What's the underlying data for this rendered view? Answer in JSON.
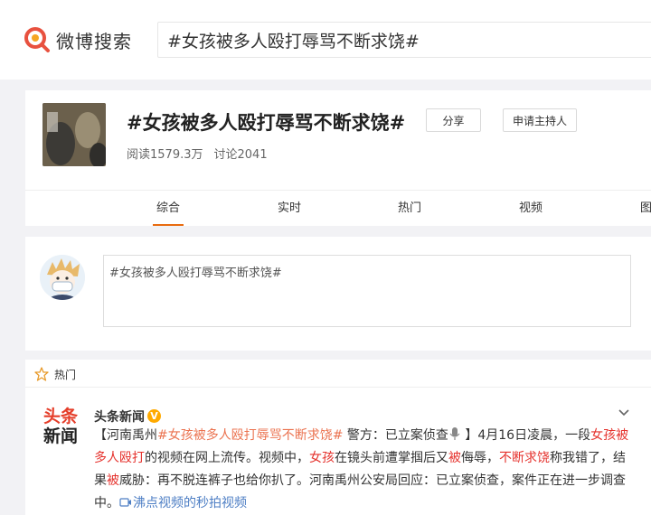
{
  "header": {
    "logo_text": "微博搜索",
    "search_value": "#女孩被多人殴打辱骂不断求饶#"
  },
  "topic": {
    "title": "#女孩被多人殴打辱骂不断求饶#",
    "share_label": "分享",
    "host_label": "申请主持人",
    "reads": "阅读1579.3万",
    "discussions": "讨论2041"
  },
  "tabs": [
    {
      "label": "综合",
      "active": true
    },
    {
      "label": "实时"
    },
    {
      "label": "热门"
    },
    {
      "label": "视频"
    },
    {
      "label": "图"
    }
  ],
  "composer": {
    "value": "#女孩被多人殴打辱骂不断求饶#"
  },
  "feed": {
    "section_label": "热门",
    "source_logo_line1": "头条",
    "source_logo_line2": "新闻",
    "author": "头条新闻",
    "post": {
      "p1": "【河南禹州",
      "p2": "#女孩被多人殴打辱骂不断求饶#",
      "p3": " 警方：已立案侦查",
      "p4": " 】4月16日凌晨，一段",
      "p5": "女孩被多人殴打",
      "p6": "的视频在网上流传。视频中，",
      "p7": "女孩",
      "p8": "在镜头前遭掌掴后又",
      "p9": "被",
      "p10": "侮辱，",
      "p11": "不断求饶",
      "p12": "称我错了，结果",
      "p13": "被",
      "p14": "威胁：再不脱连裤子也给你扒了。河南禹州公安局回应：已立案侦查，案件正在进一步调查中。",
      "p15": "沸点视频的秒拍视频"
    }
  },
  "colors": {
    "accent_orange": "#e86b0f",
    "highlight_red": "#e5322d",
    "logo_red": "#e53e2a",
    "verified_gold": "#ffaa00"
  }
}
